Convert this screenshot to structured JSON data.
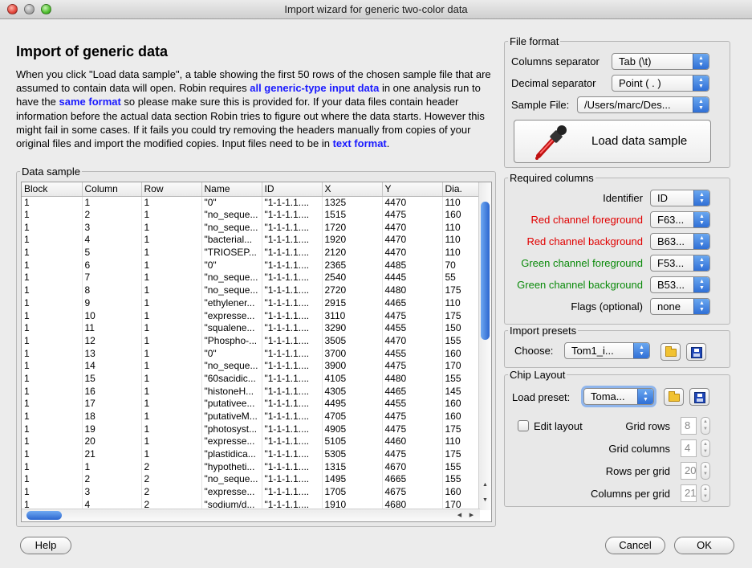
{
  "window": {
    "title": "Import wizard for generic two-color data"
  },
  "heading": "Import of generic data",
  "intro": {
    "p1": "When you click \"Load data sample\", a table showing the first 50 rows of the chosen sample file that are assumed to contain data will open. Robin requires ",
    "hl1": "all generic-type input data",
    "p2": " in one analysis run to have the ",
    "hl2": "same format",
    "p3": " so please make sure this is provided for. If your data files contain header information before the actual data section Robin tries to figure out where the data starts. However this might fail in some cases. If it fails you could try removing the headers manually from copies of your original files and import the modified copies. Input files need to be in ",
    "hl3": "text format",
    "p4": "."
  },
  "file_format": {
    "legend": "File format",
    "col_sep_label": "Columns separator",
    "col_sep_value": "Tab (\\t)",
    "dec_sep_label": "Decimal separator",
    "dec_sep_value": "Point ( . )",
    "sample_file_label": "Sample File:",
    "sample_file_value": "/Users/marc/Des...",
    "load_button": "Load data sample",
    "load_icon": "pipette-icon"
  },
  "required": {
    "legend": "Required columns",
    "identifier_label": "Identifier",
    "identifier_value": "ID",
    "red_fg_label": "Red channel foreground",
    "red_fg_value": "F63...",
    "red_bg_label": "Red channel background",
    "red_bg_value": "B63...",
    "green_fg_label": "Green channel foreground",
    "green_fg_value": "F53...",
    "green_bg_label": "Green channel background",
    "green_bg_value": "B53...",
    "flags_label": "Flags (optional)",
    "flags_value": "none"
  },
  "presets": {
    "legend": "Import presets",
    "choose_label": "Choose:",
    "choose_value": "Tom1_i..."
  },
  "chip": {
    "legend": "Chip Layout",
    "load_label": "Load preset:",
    "load_value": "Toma...",
    "edit_label": "Edit layout",
    "grid_rows_label": "Grid rows",
    "grid_rows_value": "8",
    "grid_cols_label": "Grid columns",
    "grid_cols_value": "4",
    "rows_per_grid_label": "Rows per grid",
    "rows_per_grid_value": "20",
    "cols_per_grid_label": "Columns per grid",
    "cols_per_grid_value": "21"
  },
  "data_sample": {
    "legend": "Data sample",
    "columns": [
      "Block",
      "Column",
      "Row",
      "Name",
      "ID",
      "X",
      "Y",
      "Dia."
    ],
    "rows": [
      [
        "1",
        "1",
        "1",
        "\"0\"",
        "\"1-1-1.1....",
        "1325",
        "4470",
        "110"
      ],
      [
        "1",
        "2",
        "1",
        "\"no_seque...",
        "\"1-1-1.1....",
        "1515",
        "4475",
        "160"
      ],
      [
        "1",
        "3",
        "1",
        "\"no_seque...",
        "\"1-1-1.1....",
        "1720",
        "4470",
        "110"
      ],
      [
        "1",
        "4",
        "1",
        "\"bacterial...",
        "\"1-1-1.1....",
        "1920",
        "4470",
        "110"
      ],
      [
        "1",
        "5",
        "1",
        "\"TRIOSEP...",
        "\"1-1-1.1....",
        "2120",
        "4470",
        "110"
      ],
      [
        "1",
        "6",
        "1",
        "\"0\"",
        "\"1-1-1.1....",
        "2365",
        "4485",
        "70"
      ],
      [
        "1",
        "7",
        "1",
        "\"no_seque...",
        "\"1-1-1.1....",
        "2540",
        "4445",
        "55"
      ],
      [
        "1",
        "8",
        "1",
        "\"no_seque...",
        "\"1-1-1.1....",
        "2720",
        "4480",
        "175"
      ],
      [
        "1",
        "9",
        "1",
        "\"ethylener...",
        "\"1-1-1.1....",
        "2915",
        "4465",
        "110"
      ],
      [
        "1",
        "10",
        "1",
        "\"expresse...",
        "\"1-1-1.1....",
        "3110",
        "4475",
        "175"
      ],
      [
        "1",
        "11",
        "1",
        "\"squalene...",
        "\"1-1-1.1....",
        "3290",
        "4455",
        "150"
      ],
      [
        "1",
        "12",
        "1",
        "\"Phospho-...",
        "\"1-1-1.1....",
        "3505",
        "4470",
        "155"
      ],
      [
        "1",
        "13",
        "1",
        "\"0\"",
        "\"1-1-1.1....",
        "3700",
        "4455",
        "160"
      ],
      [
        "1",
        "14",
        "1",
        "\"no_seque...",
        "\"1-1-1.1....",
        "3900",
        "4475",
        "170"
      ],
      [
        "1",
        "15",
        "1",
        "\"60sacidic...",
        "\"1-1-1.1....",
        "4105",
        "4480",
        "155"
      ],
      [
        "1",
        "16",
        "1",
        "\"histoneH...",
        "\"1-1-1.1....",
        "4305",
        "4465",
        "145"
      ],
      [
        "1",
        "17",
        "1",
        "\"putativee...",
        "\"1-1-1.1....",
        "4495",
        "4455",
        "160"
      ],
      [
        "1",
        "18",
        "1",
        "\"putativeM...",
        "\"1-1-1.1....",
        "4705",
        "4475",
        "160"
      ],
      [
        "1",
        "19",
        "1",
        "\"photosyst...",
        "\"1-1-1.1....",
        "4905",
        "4475",
        "175"
      ],
      [
        "1",
        "20",
        "1",
        "\"expresse...",
        "\"1-1-1.1....",
        "5105",
        "4460",
        "110"
      ],
      [
        "1",
        "21",
        "1",
        "\"plastidica...",
        "\"1-1-1.1....",
        "5305",
        "4475",
        "175"
      ],
      [
        "1",
        "1",
        "2",
        "\"hypotheti...",
        "\"1-1-1.1....",
        "1315",
        "4670",
        "155"
      ],
      [
        "1",
        "2",
        "2",
        "\"no_seque...",
        "\"1-1-1.1....",
        "1495",
        "4665",
        "155"
      ],
      [
        "1",
        "3",
        "2",
        "\"expresse...",
        "\"1-1-1.1....",
        "1705",
        "4675",
        "160"
      ],
      [
        "1",
        "4",
        "2",
        "\"sodium/d...",
        "\"1-1-1.1....",
        "1910",
        "4680",
        "170"
      ]
    ]
  },
  "buttons": {
    "help": "Help",
    "cancel": "Cancel",
    "ok": "OK"
  }
}
